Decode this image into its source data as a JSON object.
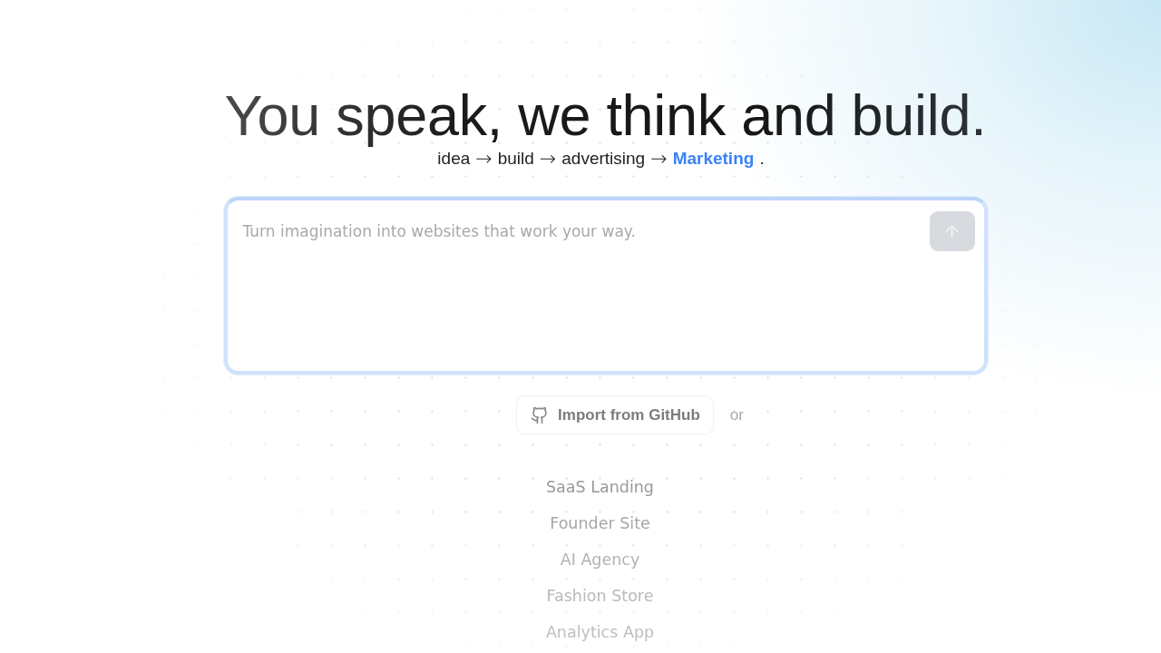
{
  "headline": "You speak, we think and build.",
  "tagline": [
    {
      "kind": "word",
      "text": "idea"
    },
    {
      "kind": "arrow",
      "text": "→"
    },
    {
      "kind": "word",
      "text": "build"
    },
    {
      "kind": "arrow",
      "text": "→"
    },
    {
      "kind": "word",
      "text": "advertising"
    },
    {
      "kind": "arrow",
      "text": "→"
    },
    {
      "kind": "accent",
      "text": "Marketing"
    },
    {
      "kind": "word",
      "text": "."
    }
  ],
  "prompt": {
    "placeholder": "Turn imagination into websites that work your way.",
    "send_button": {
      "disabled": true
    }
  },
  "import_button": {
    "label": "Import from GitHub"
  },
  "separator": "or",
  "suggestions": [
    "SaaS Landing",
    "Founder Site",
    "AI Agency",
    "Fashion Store",
    "Analytics App"
  ]
}
